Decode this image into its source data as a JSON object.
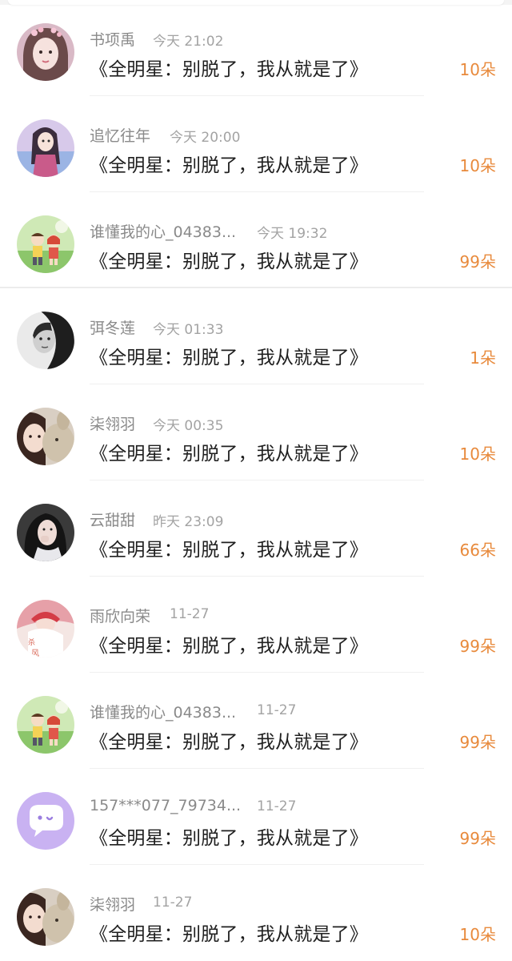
{
  "message_text": "《全明星：别脱了，我从就是了》",
  "colors": {
    "count": "#e88a3c",
    "username": "#8a8a8a",
    "time": "#a3a3a3",
    "text": "#1f1f1f"
  },
  "records": [
    {
      "user": "书项禹",
      "time": "今天 21:02",
      "count": "10朵",
      "avatar": "girl-portrait"
    },
    {
      "user": "追忆往年",
      "time": "今天 20:00",
      "count": "10朵",
      "avatar": "anime-girl"
    },
    {
      "user": "谁懂我的心_04383...",
      "time": "今天 19:32",
      "count": "99朵",
      "avatar": "cartoon-kids"
    },
    {
      "user": "弭冬莲",
      "time": "今天 01:33",
      "count": "1朵",
      "avatar": "bw-portrait"
    },
    {
      "user": "柒翎羽",
      "time": "今天 00:35",
      "count": "10朵",
      "avatar": "girl-with-plush"
    },
    {
      "user": "云甜甜",
      "time": "昨天 23:09",
      "count": "66朵",
      "avatar": "dark-hair-girl"
    },
    {
      "user": "雨欣向荣",
      "time": "11-27",
      "count": "99朵",
      "avatar": "art-illustration"
    },
    {
      "user": "谁懂我的心_04383...",
      "time": "11-27",
      "count": "99朵",
      "avatar": "cartoon-kids"
    },
    {
      "user": "157***077_79734...",
      "time": "11-27",
      "count": "99朵",
      "avatar": "chat-bubble"
    },
    {
      "user": "柒翎羽",
      "time": "11-27",
      "count": "10朵",
      "avatar": "girl-with-plush"
    }
  ]
}
